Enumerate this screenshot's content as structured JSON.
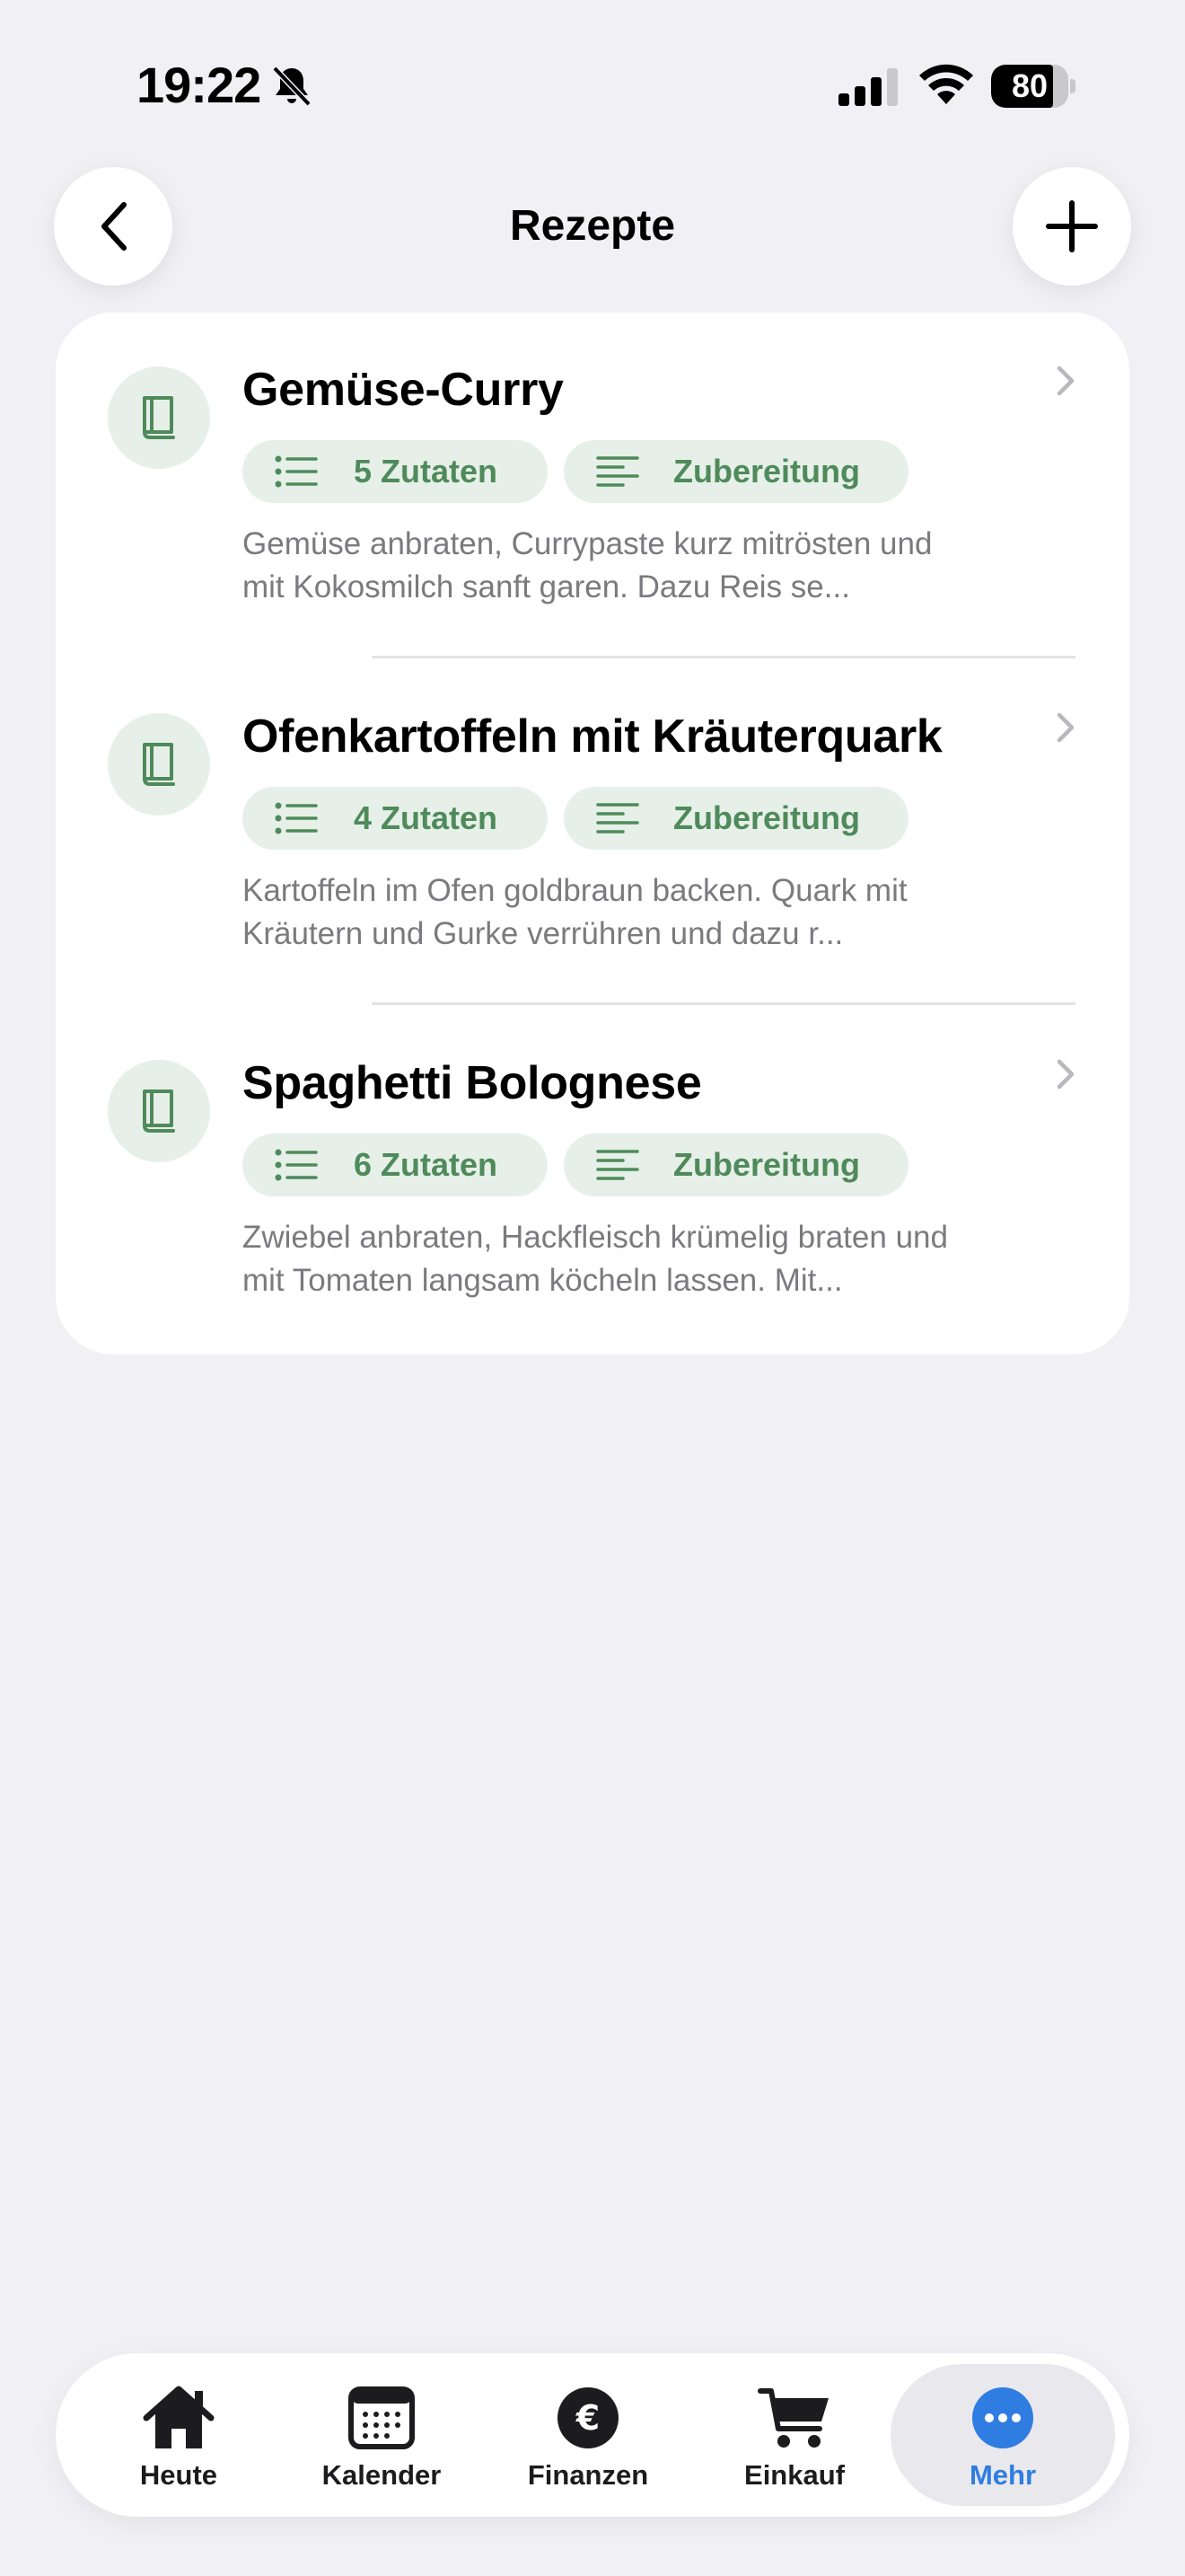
{
  "status_bar": {
    "time": "19:22",
    "battery_percent": 80,
    "battery_label": "80"
  },
  "header": {
    "title": "Rezepte",
    "back_icon": "chevron-left-icon",
    "add_icon": "plus-icon"
  },
  "recipes": [
    {
      "title": "Gemüse-Curry",
      "ingredients_label": "5 Zutaten",
      "prep_label": "Zubereitung",
      "description": "Gemüse anbraten, Currypaste kurz mitrösten und mit Kokosmilch sanft garen. Dazu Reis se..."
    },
    {
      "title": "Ofenkartoffeln mit Kräuterquark",
      "ingredients_label": "4 Zutaten",
      "prep_label": "Zubereitung",
      "description": "Kartoffeln im Ofen goldbraun backen. Quark mit Kräutern und Gurke verrühren und dazu r..."
    },
    {
      "title": "Spaghetti Bolognese",
      "ingredients_label": "6 Zutaten",
      "prep_label": "Zubereitung",
      "description": "Zwiebel anbraten, Hackfleisch krümelig braten und mit Tomaten langsam köcheln lassen. Mit..."
    }
  ],
  "tab_bar": {
    "items": [
      {
        "label": "Heute",
        "icon": "house-icon"
      },
      {
        "label": "Kalender",
        "icon": "calendar-icon"
      },
      {
        "label": "Finanzen",
        "icon": "euro-icon"
      },
      {
        "label": "Einkauf",
        "icon": "cart-icon"
      },
      {
        "label": "Mehr",
        "icon": "more-icon",
        "active": true
      }
    ]
  },
  "colors": {
    "background": "#f1f0f5",
    "accent_green": "#4f8a5b",
    "chip_bg": "#e6f0e8",
    "active_tab": "#2f7de1"
  }
}
